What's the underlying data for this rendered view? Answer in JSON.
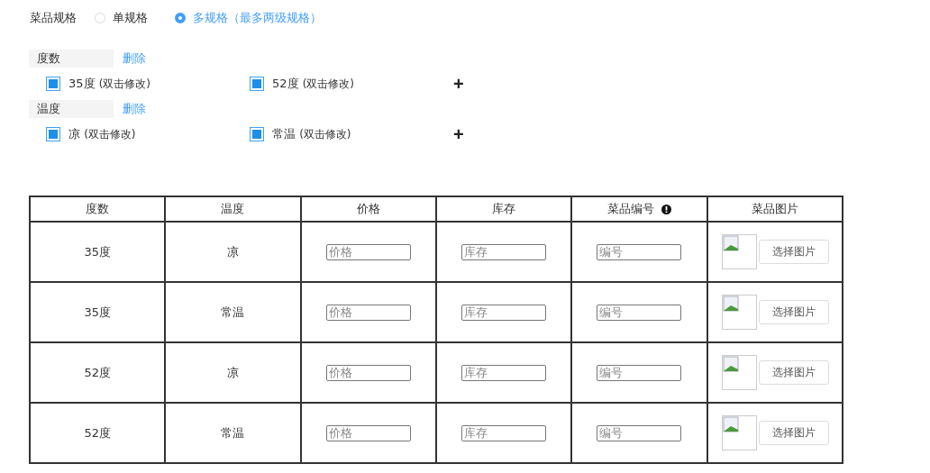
{
  "spec_type": {
    "label": "菜品规格",
    "options": [
      {
        "label": "单规格",
        "selected": false
      },
      {
        "label": "多规格（最多两级规格）",
        "selected": true
      }
    ]
  },
  "spec_groups": [
    {
      "name": "度数",
      "delete": "删除",
      "add": "+",
      "values": [
        {
          "label": "35度",
          "hint": "(双击修改)",
          "checked": true
        },
        {
          "label": "52度",
          "hint": "(双击修改)",
          "checked": true
        }
      ]
    },
    {
      "name": "温度",
      "delete": "删除",
      "add": "+",
      "values": [
        {
          "label": "凉",
          "hint": "(双击修改)",
          "checked": true
        },
        {
          "label": "常温",
          "hint": "(双击修改)",
          "checked": true
        }
      ]
    }
  ],
  "table": {
    "columns": [
      {
        "label": "度数",
        "info": false
      },
      {
        "label": "温度",
        "info": false
      },
      {
        "label": "价格",
        "info": false
      },
      {
        "label": "库存",
        "info": false
      },
      {
        "label": "菜品编号",
        "info": true
      },
      {
        "label": "菜品图片",
        "info": false
      }
    ],
    "rows": [
      {
        "degree": "35度",
        "temperature": "凉",
        "price_placeholder": "价格",
        "stock_placeholder": "库存",
        "code_placeholder": "编号",
        "image_button": "选择图片"
      },
      {
        "degree": "35度",
        "temperature": "常温",
        "price_placeholder": "价格",
        "stock_placeholder": "库存",
        "code_placeholder": "编号",
        "image_button": "选择图片"
      },
      {
        "degree": "52度",
        "temperature": "凉",
        "price_placeholder": "价格",
        "stock_placeholder": "库存",
        "code_placeholder": "编号",
        "image_button": "选择图片"
      },
      {
        "degree": "52度",
        "temperature": "常温",
        "price_placeholder": "价格",
        "stock_placeholder": "库存",
        "code_placeholder": "编号",
        "image_button": "选择图片"
      }
    ]
  }
}
